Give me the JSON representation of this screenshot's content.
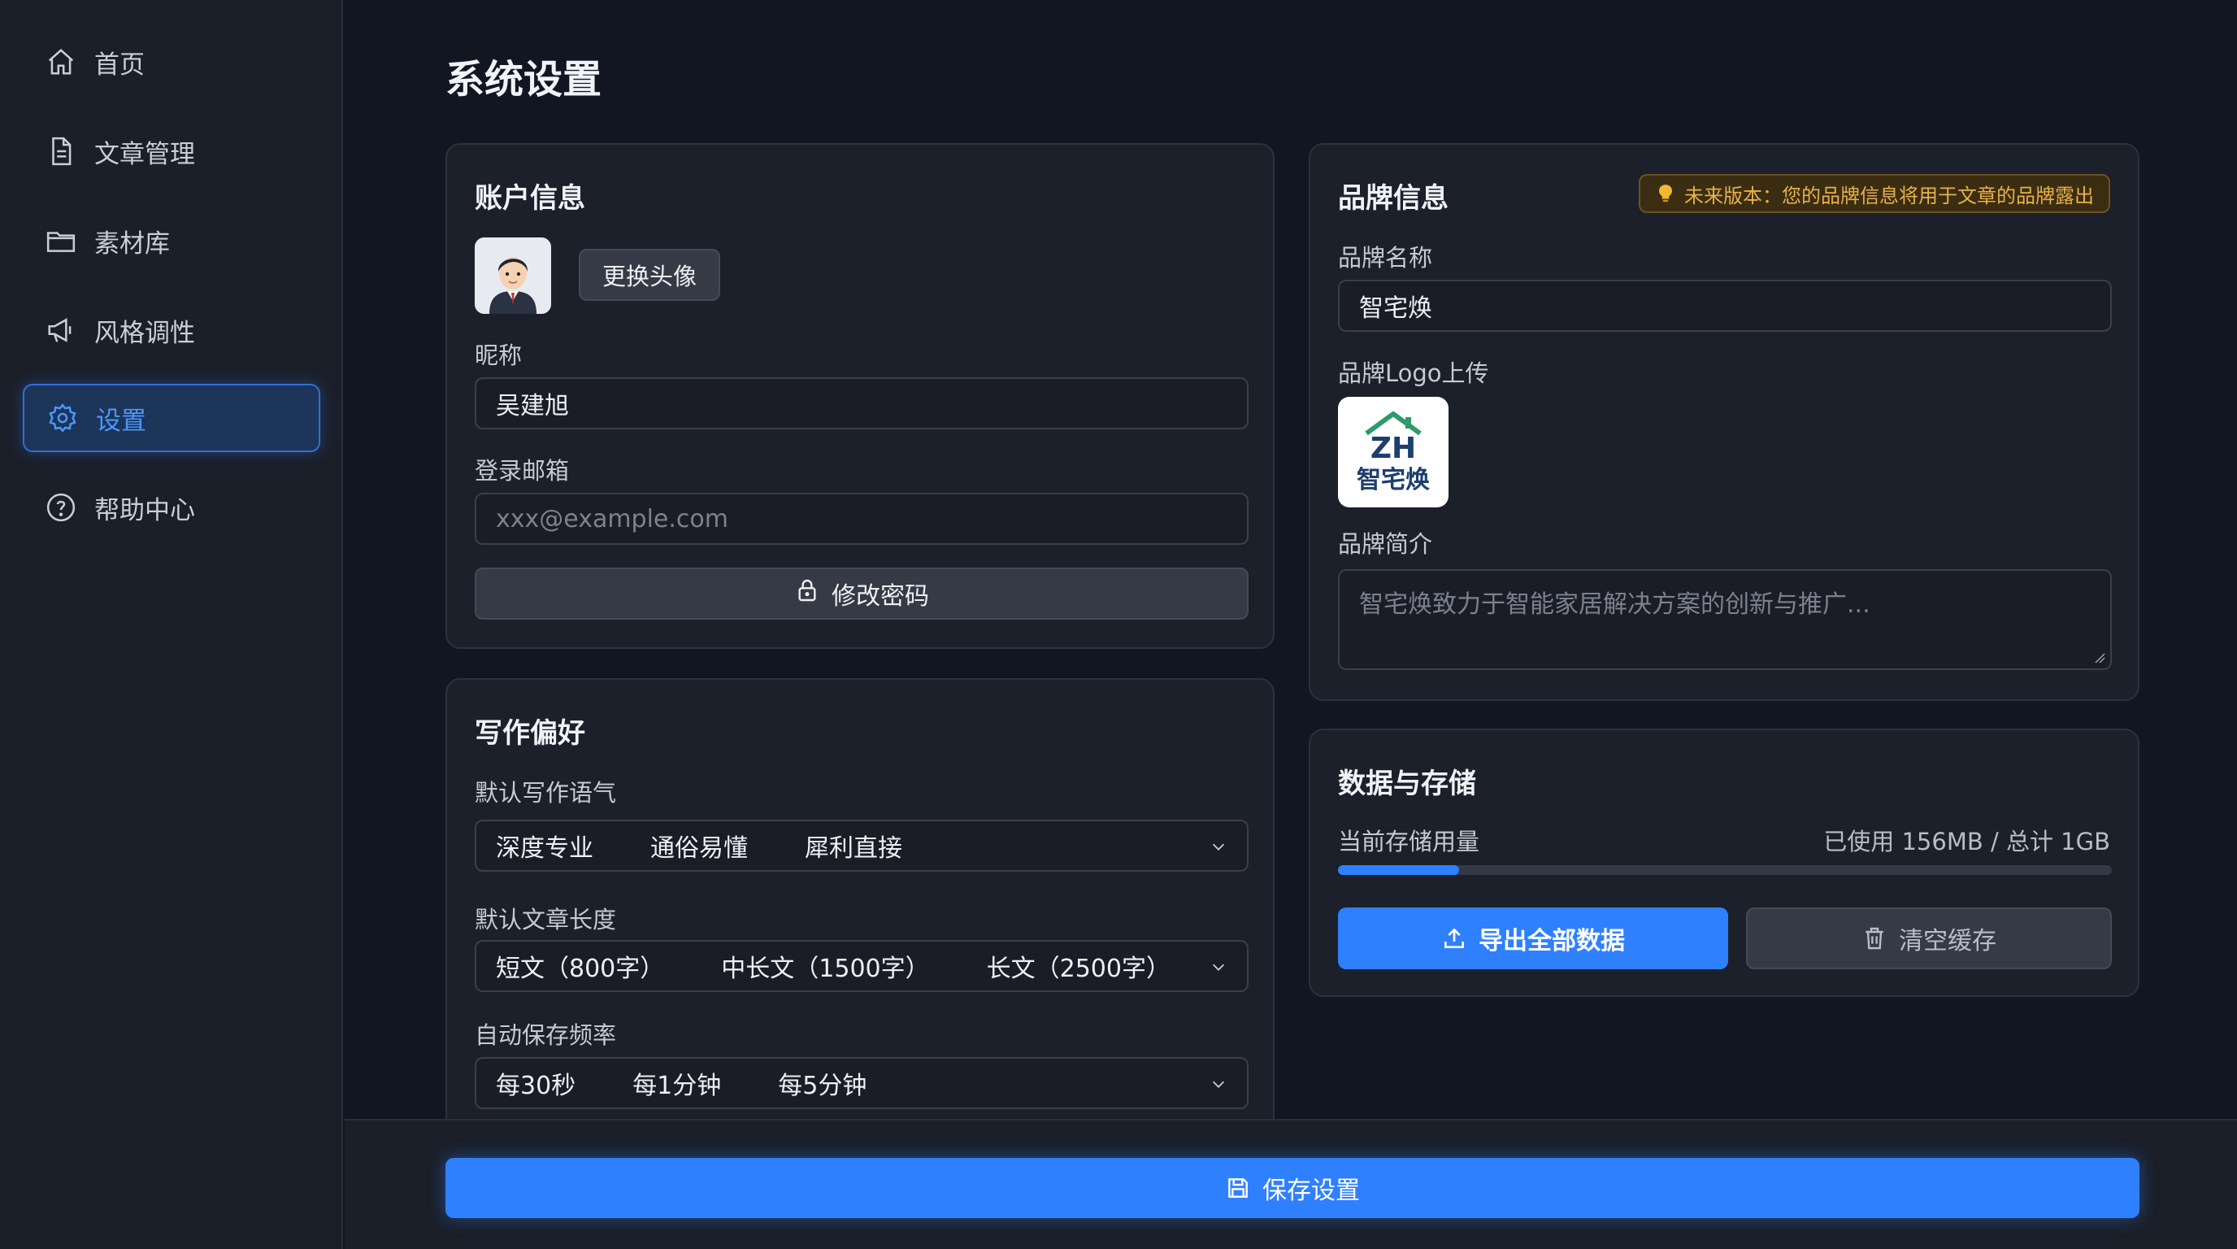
{
  "sidebar": {
    "items": [
      {
        "label": "首页",
        "icon": "home-icon"
      },
      {
        "label": "文章管理",
        "icon": "document-icon"
      },
      {
        "label": "素材库",
        "icon": "folder-icon"
      },
      {
        "label": "风格调性",
        "icon": "megaphone-icon"
      },
      {
        "label": "设置",
        "icon": "gear-icon",
        "active": true
      },
      {
        "label": "帮助中心",
        "icon": "help-icon"
      }
    ]
  },
  "page": {
    "title": "系统设置"
  },
  "account": {
    "title": "账户信息",
    "change_avatar": "更换头像",
    "nickname_label": "昵称",
    "nickname_value": "吴建旭",
    "email_label": "登录邮箱",
    "email_placeholder": "xxx@example.com",
    "change_password": "修改密码"
  },
  "writing": {
    "title": "写作偏好",
    "tone_label": "默认写作语气",
    "tone_options": [
      "深度专业",
      "通俗易懂",
      "犀利直接"
    ],
    "length_label": "默认文章长度",
    "length_options": [
      "短文（800字）",
      "中长文（1500字）",
      "长文（2500字）"
    ],
    "autosave_label": "自动保存频率",
    "autosave_options": [
      "每30秒",
      "每1分钟",
      "每5分钟"
    ]
  },
  "brand": {
    "title": "品牌信息",
    "badge": "未来版本：您的品牌信息将用于文章的品牌露出",
    "name_label": "品牌名称",
    "name_value": "智宅焕",
    "logo_label": "品牌Logo上传",
    "logo_text": "智宅焕",
    "logo_mark": "ZH",
    "intro_label": "品牌简介",
    "intro_placeholder": "智宅焕致力于智能家居解决方案的创新与推广..."
  },
  "storage": {
    "title": "数据与存储",
    "usage_label": "当前存储用量",
    "usage_value": "已使用 156MB / 总计 1GB",
    "usage_fraction": 0.156,
    "export_label": "导出全部数据",
    "clear_label": "清空缓存"
  },
  "footer": {
    "save_label": "保存设置"
  },
  "colors": {
    "accent": "#2f80ff",
    "badge": "#e8b04a"
  }
}
